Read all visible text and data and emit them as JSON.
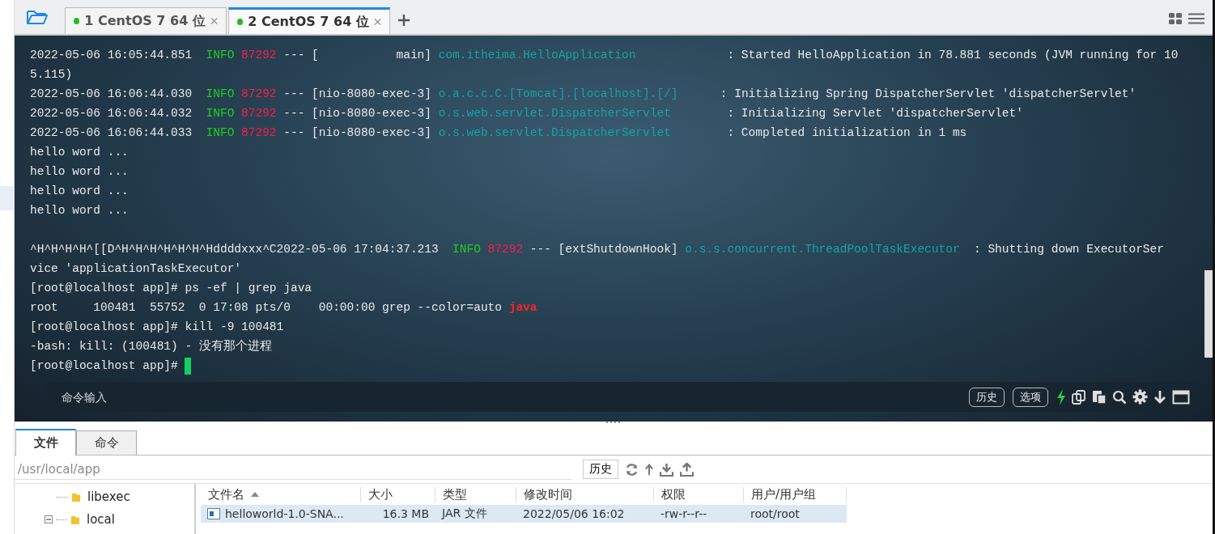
{
  "tabs": [
    {
      "label": "1 CentOS 7 64 位",
      "connected": true,
      "selected": false
    },
    {
      "label": "2 CentOS 7 64 位",
      "connected": true,
      "selected": true
    }
  ],
  "terminal": {
    "lines": [
      {
        "segments": [
          {
            "kind": "plain",
            "text": "2022-05-06 16:05:44.851  "
          },
          {
            "kind": "info",
            "text": "INFO"
          },
          {
            "kind": "pid",
            "text": "87292"
          },
          {
            "kind": "plain",
            "text": " --- [           main] "
          },
          {
            "kind": "class",
            "text": "com.itheima.HelloApplication"
          },
          {
            "kind": "plain",
            "text": "             : Started HelloApplication in 78.881 seconds (JVM running for 10"
          }
        ]
      },
      {
        "segments": [
          {
            "kind": "plain",
            "text": "5.115)"
          }
        ]
      },
      {
        "segments": [
          {
            "kind": "plain",
            "text": "2022-05-06 16:06:44.030  "
          },
          {
            "kind": "info",
            "text": "INFO"
          },
          {
            "kind": "pid",
            "text": "87292"
          },
          {
            "kind": "plain",
            "text": " --- [nio-8080-exec-3] "
          },
          {
            "kind": "class",
            "text": "o.a.c.c.C.[Tomcat].[localhost].[/]"
          },
          {
            "kind": "plain",
            "text": "      : Initializing Spring DispatcherServlet 'dispatcherServlet'"
          }
        ]
      },
      {
        "segments": [
          {
            "kind": "plain",
            "text": "2022-05-06 16:06:44.032  "
          },
          {
            "kind": "info",
            "text": "INFO"
          },
          {
            "kind": "pid",
            "text": "87292"
          },
          {
            "kind": "plain",
            "text": " --- [nio-8080-exec-3] "
          },
          {
            "kind": "class",
            "text": "o.s.web.servlet.DispatcherServlet"
          },
          {
            "kind": "plain",
            "text": "        : Initializing Servlet 'dispatcherServlet'"
          }
        ]
      },
      {
        "segments": [
          {
            "kind": "plain",
            "text": "2022-05-06 16:06:44.033  "
          },
          {
            "kind": "info",
            "text": "INFO"
          },
          {
            "kind": "pid",
            "text": "87292"
          },
          {
            "kind": "plain",
            "text": " --- [nio-8080-exec-3] "
          },
          {
            "kind": "class",
            "text": "o.s.web.servlet.DispatcherServlet"
          },
          {
            "kind": "plain",
            "text": "        : Completed initialization in 1 ms"
          }
        ]
      },
      {
        "segments": [
          {
            "kind": "plain",
            "text": "hello word ..."
          }
        ]
      },
      {
        "segments": [
          {
            "kind": "plain",
            "text": "hello word ..."
          }
        ]
      },
      {
        "segments": [
          {
            "kind": "plain",
            "text": "hello word ..."
          }
        ]
      },
      {
        "segments": [
          {
            "kind": "plain",
            "text": "hello word ..."
          }
        ]
      },
      {
        "gap_before": true,
        "segments": [
          {
            "kind": "plain",
            "text": "^H^H^H^H^[[D^H^H^H^H^H^H^Hddddxxx^C2022-05-06 17:04:37.213  "
          },
          {
            "kind": "info",
            "text": "INFO"
          },
          {
            "kind": "pid",
            "text": "87292"
          },
          {
            "kind": "plain",
            "text": " --- [extShutdownHook] "
          },
          {
            "kind": "class",
            "text": "o.s.s.concurrent.ThreadPoolTaskExecutor"
          },
          {
            "kind": "plain",
            "text": "  : Shutting down ExecutorSer"
          }
        ]
      },
      {
        "segments": [
          {
            "kind": "plain",
            "text": "vice 'applicationTaskExecutor'"
          }
        ]
      },
      {
        "segments": [
          {
            "kind": "plain",
            "text": "[root@localhost app]# ps -ef | grep java"
          }
        ]
      },
      {
        "segments": [
          {
            "kind": "plain",
            "text": "root     100481  55752  0 17:08 pts/0    00:00:00 grep --color=auto "
          },
          {
            "kind": "match",
            "text": "java"
          }
        ]
      },
      {
        "segments": [
          {
            "kind": "plain",
            "text": "[root@localhost app]# kill -9 100481"
          }
        ]
      },
      {
        "segments": [
          {
            "kind": "plain",
            "text": "-bash: kill: (100481) - 没有那个进程"
          }
        ]
      },
      {
        "cursor": true,
        "segments": [
          {
            "kind": "plain",
            "text": "[root@localhost app]# "
          }
        ]
      }
    ]
  },
  "command_bar": {
    "placeholder": "命令输入",
    "buttons": [
      "历史",
      "选项"
    ]
  },
  "bottom_tabs": [
    {
      "label": "文件",
      "selected": true
    },
    {
      "label": "命令",
      "selected": false
    }
  ],
  "path_field": {
    "value": "/usr/local/app"
  },
  "history_button": "历史",
  "tree": [
    {
      "label": "libexec",
      "kind": "leaf"
    },
    {
      "label": "local",
      "kind": "node",
      "expanded": true
    }
  ],
  "file_table": {
    "columns": [
      {
        "label": "文件名",
        "sorted": true
      },
      {
        "label": "大小",
        "sorted": false
      },
      {
        "label": "类型",
        "sorted": false
      },
      {
        "label": "修改时间",
        "sorted": false
      },
      {
        "label": "权限",
        "sorted": false
      },
      {
        "label": "用户/用户组",
        "sorted": false
      }
    ],
    "rows": [
      {
        "cells": [
          "helloworld-1.0-SNA...",
          "16.3 MB",
          "JAR 文件",
          "2022/05/06 16:02",
          "-rw-r--r--",
          "root/root"
        ],
        "selected": true
      }
    ]
  }
}
